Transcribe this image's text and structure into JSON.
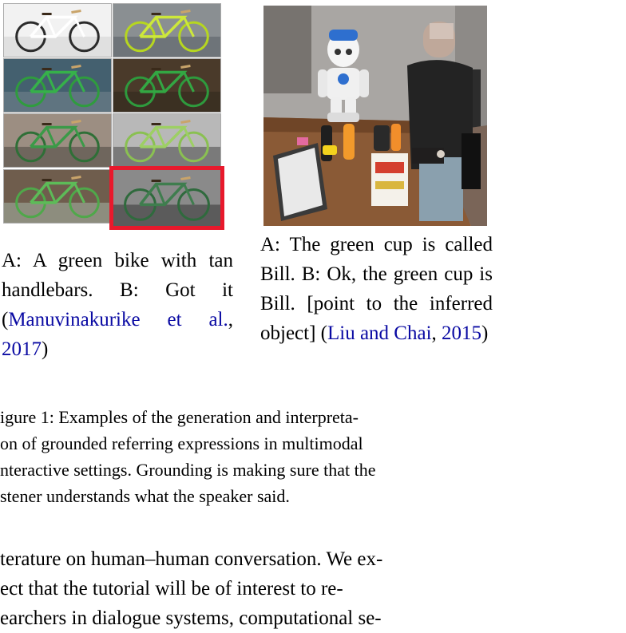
{
  "bike_grid": {
    "cells": [
      {
        "frame": "#ffffff",
        "bike": "#2b2b2b",
        "bg": "#f2f2f2",
        "ground": "#e0e0e0"
      },
      {
        "frame": "#cde83a",
        "bike": "#b6d620",
        "bg": "#8a8f92",
        "ground": "#6e7479"
      },
      {
        "frame": "#36b14a",
        "bike": "#2f9c3e",
        "bg": "#44606f",
        "ground": "#5f7480"
      },
      {
        "frame": "#33a743",
        "bike": "#2e9a3d",
        "bg": "#4a3a2a",
        "ground": "#3b3022"
      },
      {
        "frame": "#3b9a48",
        "bike": "#2f6f37",
        "bg": "#9c8e82",
        "ground": "#6f665d"
      },
      {
        "frame": "#9dcf64",
        "bike": "#8ac052",
        "bg": "#b8b8b8",
        "ground": "#7a7a7a"
      },
      {
        "frame": "#5dbb58",
        "bike": "#4fa84a",
        "bg": "#6f5d4d",
        "ground": "#8d8d7e"
      },
      {
        "frame": "#3f7d4e",
        "bike": "#2f6a3d",
        "bg": "#8a8a8a",
        "ground": "#5b5b5b"
      }
    ],
    "selected_index": 7,
    "highlight_color": "#e8192c"
  },
  "caption_left": {
    "text": "A: A green bike with tan handlebars.  B: Got it (",
    "cite_author": "Manuvinakurike et al.",
    "cite_sep": ", ",
    "cite_year": "2017",
    "close": ")"
  },
  "caption_right": {
    "text": "A: The green cup is called Bill.  B: Ok, the green cup is Bill. [point to the inferred object] (",
    "cite_author": "Liu and Chai",
    "cite_sep": ", ",
    "cite_year": "2015",
    "close": ")"
  },
  "figure_caption": {
    "lines": [
      "igure 1:  Examples of the generation and interpreta-",
      "on of grounded referring expressions in multimodal",
      "nteractive settings. Grounding is making sure that the",
      "stener understands what the speaker said."
    ]
  },
  "body_text": {
    "lines": [
      "terature on human–human conversation.  We ex-",
      "ect  that  the  tutorial  will  be  of  interest  to  re-",
      "earchers in dialogue systems, computational se-"
    ]
  },
  "colors": {
    "citation": "#0a0aa3",
    "text": "#000000"
  }
}
